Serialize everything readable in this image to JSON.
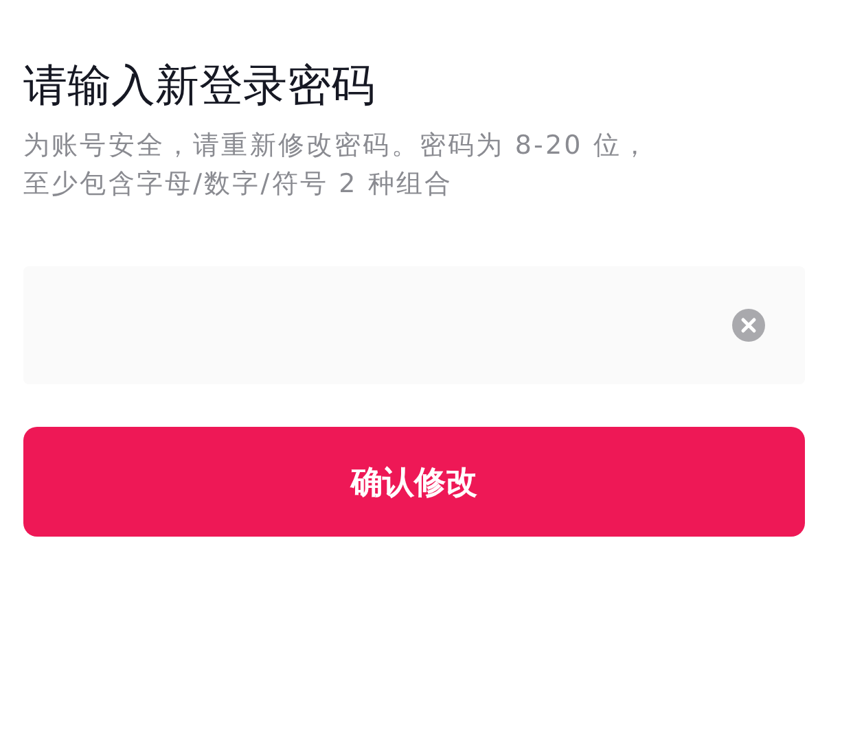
{
  "title": "请输入新登录密码",
  "description": "为账号安全，请重新修改密码。密码为 8-20 位，至少包含字母/数字/符号 2 种组合",
  "confirm_button": {
    "label": "确认修改"
  }
}
